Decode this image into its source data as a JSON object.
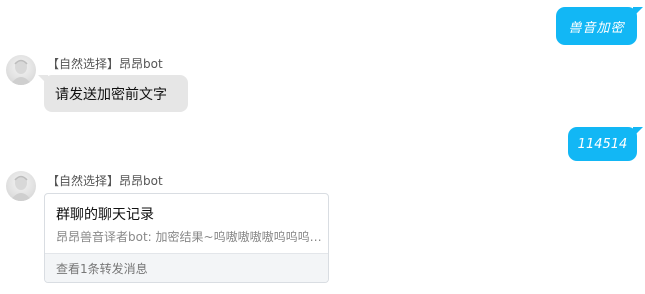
{
  "messages": [
    {
      "direction": "outgoing",
      "text": "兽音加密"
    },
    {
      "direction": "incoming",
      "sender": "【自然选择】昂昂bot",
      "text": "请发送加密前文字"
    },
    {
      "direction": "outgoing",
      "text": "114514"
    },
    {
      "direction": "incoming",
      "sender": "【自然选择】昂昂bot",
      "forward_card": {
        "title": "群聊的聊天记录",
        "preview": "昂昂兽音译者bot: 加密结果~呜嗷嗷嗷嗷呜呜呜…",
        "footer": "查看1条转发消息"
      }
    }
  ],
  "colors": {
    "outgoing_bubble": "#12b7f5",
    "incoming_bubble": "#e6e6e6",
    "card_footer_bg": "#f3f5f7"
  },
  "icons": {
    "avatar": "bot-avatar"
  }
}
